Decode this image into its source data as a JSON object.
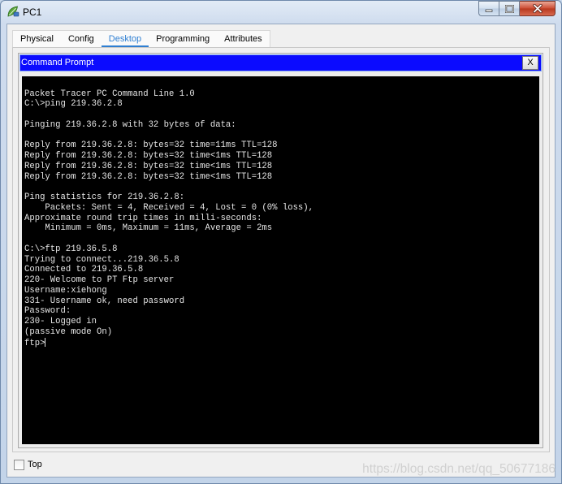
{
  "window": {
    "title": "PC1",
    "icon": "packet-tracer-pc-icon",
    "minimize_icon": "minimize-icon",
    "maximize_icon": "maximize-icon",
    "close_icon": "close-icon"
  },
  "tabs": [
    {
      "label": "Physical",
      "selected": false
    },
    {
      "label": "Config",
      "selected": false
    },
    {
      "label": "Desktop",
      "selected": true
    },
    {
      "label": "Programming",
      "selected": false
    },
    {
      "label": "Attributes",
      "selected": false
    }
  ],
  "command_prompt": {
    "title": "Command Prompt",
    "close_label": "X",
    "lines": [
      "Packet Tracer PC Command Line 1.0",
      "C:\\>ping 219.36.2.8",
      "",
      "Pinging 219.36.2.8 with 32 bytes of data:",
      "",
      "Reply from 219.36.2.8: bytes=32 time=11ms TTL=128",
      "Reply from 219.36.2.8: bytes=32 time<1ms TTL=128",
      "Reply from 219.36.2.8: bytes=32 time<1ms TTL=128",
      "Reply from 219.36.2.8: bytes=32 time<1ms TTL=128",
      "",
      "Ping statistics for 219.36.2.8:",
      "    Packets: Sent = 4, Received = 4, Lost = 0 (0% loss),",
      "Approximate round trip times in milli-seconds:",
      "    Minimum = 0ms, Maximum = 11ms, Average = 2ms",
      "",
      "C:\\>ftp 219.36.5.8",
      "Trying to connect...219.36.5.8",
      "Connected to 219.36.5.8",
      "220- Welcome to PT Ftp server",
      "Username:xiehong",
      "331- Username ok, need password",
      "Password:",
      "230- Logged in",
      "(passive mode On)",
      "ftp>"
    ]
  },
  "footer": {
    "top_label": "Top",
    "top_checked": false
  },
  "watermark": "https://blog.csdn.net/qq_50677186",
  "colors": {
    "title_bar_blue": "#0b0bff",
    "selected_tab": "#2f7fd2",
    "terminal_bg": "#000000",
    "terminal_text": "#e6e6e6",
    "close_red": "#cd4f36"
  }
}
